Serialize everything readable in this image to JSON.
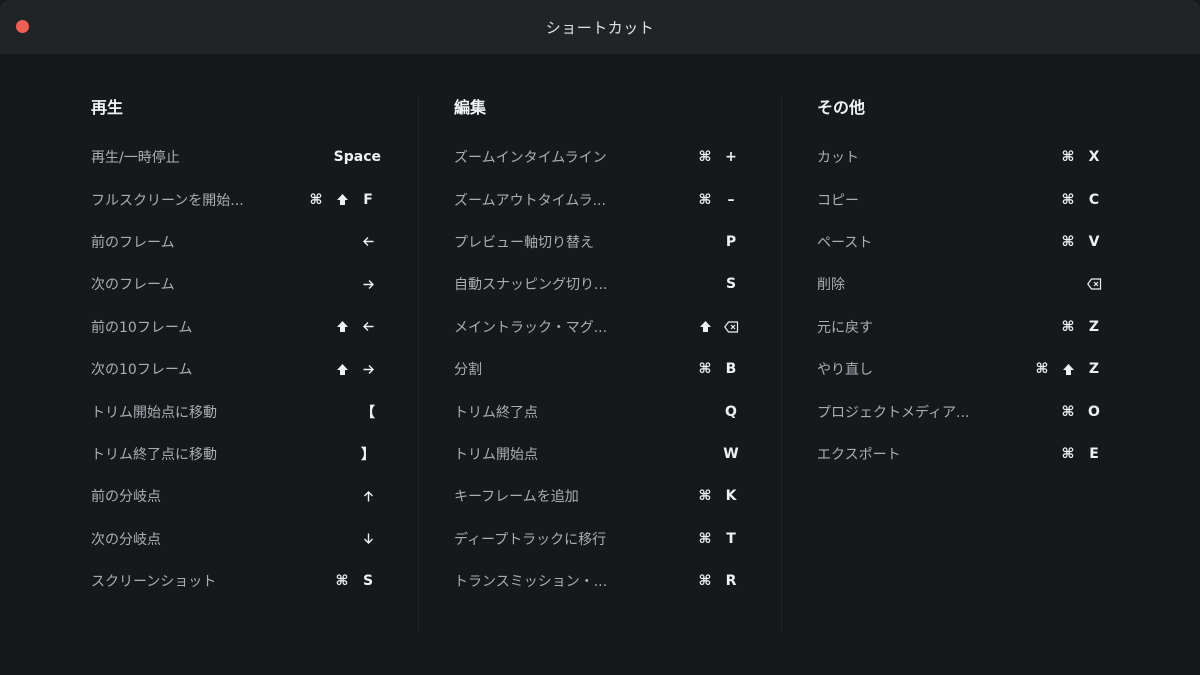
{
  "window": {
    "title": "ショートカット"
  },
  "columns": [
    {
      "heading": "再生",
      "rows": [
        {
          "label": "再生/一時停止",
          "keys": [
            "Space"
          ]
        },
        {
          "label": "フルスクリーンを開始...",
          "keys": [
            "⌘",
            "shift-icon",
            "F"
          ]
        },
        {
          "label": "前のフレーム",
          "keys": [
            "arrow-left-icon"
          ]
        },
        {
          "label": "次のフレーム",
          "keys": [
            "arrow-right-icon"
          ]
        },
        {
          "label": "前の10フレーム",
          "keys": [
            "shift-icon",
            "arrow-left-icon"
          ]
        },
        {
          "label": "次の10フレーム",
          "keys": [
            "shift-icon",
            "arrow-right-icon"
          ]
        },
        {
          "label": "トリム開始点に移動",
          "keys": [
            "【"
          ]
        },
        {
          "label": "トリム終了点に移動",
          "keys": [
            "】"
          ]
        },
        {
          "label": "前の分岐点",
          "keys": [
            "arrow-up-icon"
          ]
        },
        {
          "label": "次の分岐点",
          "keys": [
            "arrow-down-icon"
          ]
        },
        {
          "label": "スクリーンショット",
          "keys": [
            "⌘",
            "S"
          ]
        }
      ]
    },
    {
      "heading": "編集",
      "rows": [
        {
          "label": "ズームインタイムライン",
          "keys": [
            "⌘",
            "+"
          ]
        },
        {
          "label": "ズームアウトタイムラ...",
          "keys": [
            "⌘",
            "–"
          ]
        },
        {
          "label": "プレビュー軸切り替え",
          "keys": [
            "P"
          ]
        },
        {
          "label": "自動スナッピング切り...",
          "keys": [
            "S"
          ]
        },
        {
          "label": "メイントラック・マグ...",
          "keys": [
            "shift-icon",
            "delete-icon"
          ]
        },
        {
          "label": "分割",
          "keys": [
            "⌘",
            "B"
          ]
        },
        {
          "label": "トリム終了点",
          "keys": [
            "Q"
          ]
        },
        {
          "label": "トリム開始点",
          "keys": [
            "W"
          ]
        },
        {
          "label": "キーフレームを追加",
          "keys": [
            "⌘",
            "K"
          ]
        },
        {
          "label": "ディープトラックに移行",
          "keys": [
            "⌘",
            "T"
          ]
        },
        {
          "label": "トランスミッション・...",
          "keys": [
            "⌘",
            "R"
          ]
        }
      ]
    },
    {
      "heading": "その他",
      "rows": [
        {
          "label": "カット",
          "keys": [
            "⌘",
            "X"
          ]
        },
        {
          "label": "コピー",
          "keys": [
            "⌘",
            "C"
          ]
        },
        {
          "label": "ペースト",
          "keys": [
            "⌘",
            "V"
          ]
        },
        {
          "label": "削除",
          "keys": [
            "delete-icon"
          ]
        },
        {
          "label": "元に戻す",
          "keys": [
            "⌘",
            "Z"
          ]
        },
        {
          "label": "やり直し",
          "keys": [
            "⌘",
            "shift-icon",
            "Z"
          ]
        },
        {
          "label": "プロジェクトメディア...",
          "keys": [
            "⌘",
            "O"
          ]
        },
        {
          "label": "エクスポート",
          "keys": [
            "⌘",
            "E"
          ]
        }
      ]
    }
  ]
}
